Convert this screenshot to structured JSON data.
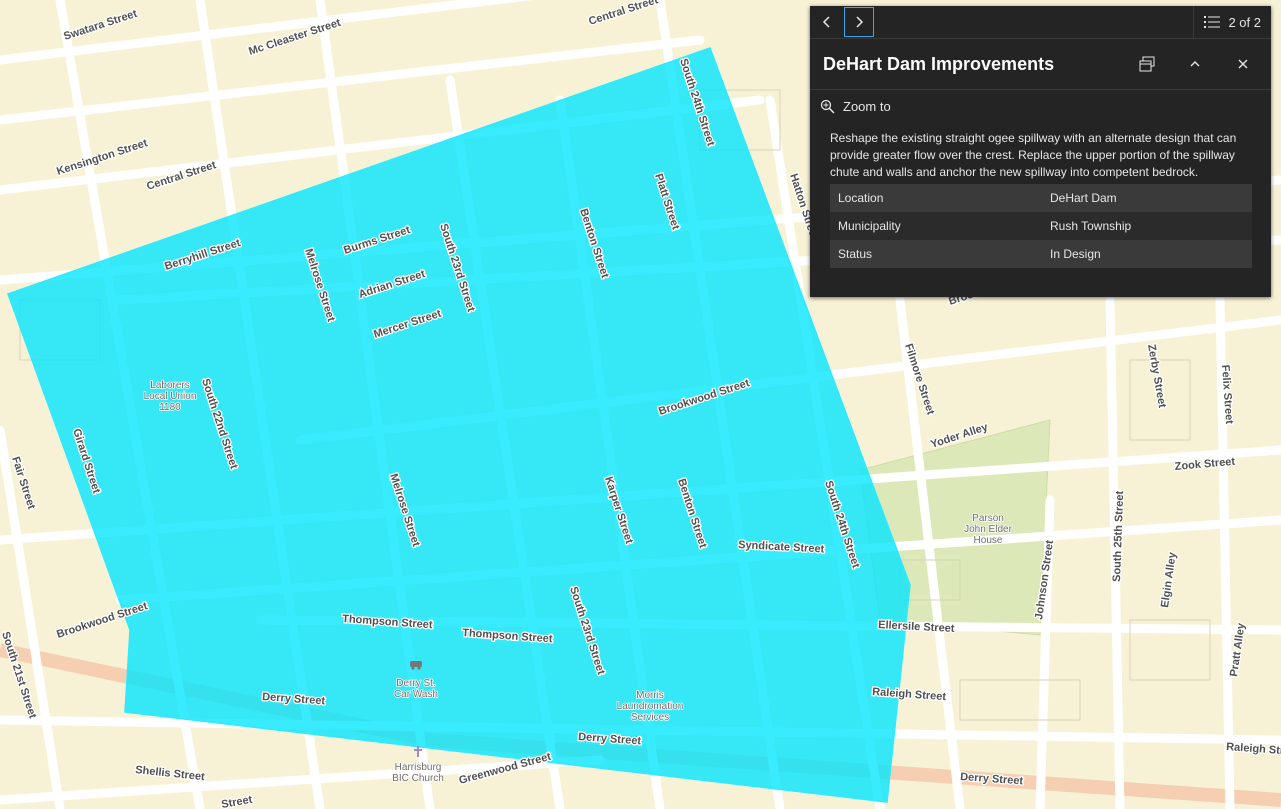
{
  "map": {
    "streets": [
      "Swatara Street",
      "Mc Cleaster Street",
      "Central Street",
      "South 24th Street",
      "Kensington Street",
      "Central Street",
      "Berryhill Street",
      "Burms Street",
      "Adrian Street",
      "Mercer Street",
      "South 23rd Street",
      "Melrose Street",
      "Benton Street",
      "Platt Street",
      "Hatton Street",
      "Brookwood Street",
      "Brookwood Street",
      "Filmore Street",
      "Yoder Alley",
      "Zook Street",
      "South 24th Street",
      "South 25th Street",
      "Zerby Street",
      "Felix Street",
      "Fair Street",
      "Girard Street",
      "South 22nd Street",
      "Melrose Street",
      "Karper Street",
      "Benton Street",
      "Syndicate Street",
      "Johnson Street",
      "Elgin Alley",
      "Pratt Alley",
      "Ellersile Street",
      "Thompson Street",
      "Thompson Street",
      "South 23rd Street",
      "Raleigh Street",
      "Raleigh Street",
      "Derry Street",
      "Derry Street",
      "Derry Street",
      "South 21st Street",
      "Brookwood Street",
      "Shellis Street",
      "Greenwood Street",
      "Street"
    ],
    "pois": [
      {
        "name": "Laborers Local Union 1180",
        "lines": [
          "Laborers",
          "Local Union",
          "1180"
        ]
      },
      {
        "name": "Parson John Elder House",
        "lines": [
          "Parson",
          "John Elder",
          "House"
        ]
      },
      {
        "name": "Derry St. Car Wash",
        "lines": [
          "Derry St.",
          "Car Wash"
        ]
      },
      {
        "name": "Morris Laundromation Services",
        "lines": [
          "Morris",
          "Laundromation",
          "Services"
        ]
      },
      {
        "name": "Harrisburg BIC Church",
        "lines": [
          "Harrisburg",
          "BIC Church"
        ]
      }
    ],
    "colors": {
      "land": "#f7f2d6",
      "road": "#ffffff",
      "arterial": "#f6cfb2",
      "park": "#dde8b8",
      "polygon_fill": "#00e5ff",
      "polygon_stroke": "#2ee9ff"
    }
  },
  "popup": {
    "prev_icon": "chevron-left-icon",
    "next_icon": "chevron-right-icon",
    "count_text": "2 of 2",
    "title": "DeHart Dam Improvements",
    "zoom_label": "Zoom to",
    "description": "Reshape the existing straight ogee spillway with an alternate design that can provide greater flow over the crest. Replace the upper portion of the spillway chute and walls and anchor the new spillway into competent bedrock.",
    "attributes": [
      {
        "field": "Location",
        "value": "DeHart Dam"
      },
      {
        "field": "Municipality",
        "value": "Rush Township"
      },
      {
        "field": "Status",
        "value": "In Design"
      }
    ],
    "theme": {
      "background": "#242424",
      "row_odd": "#3a3a3a",
      "row_even": "#2b2b2b",
      "accent": "#3fa3ea"
    }
  }
}
